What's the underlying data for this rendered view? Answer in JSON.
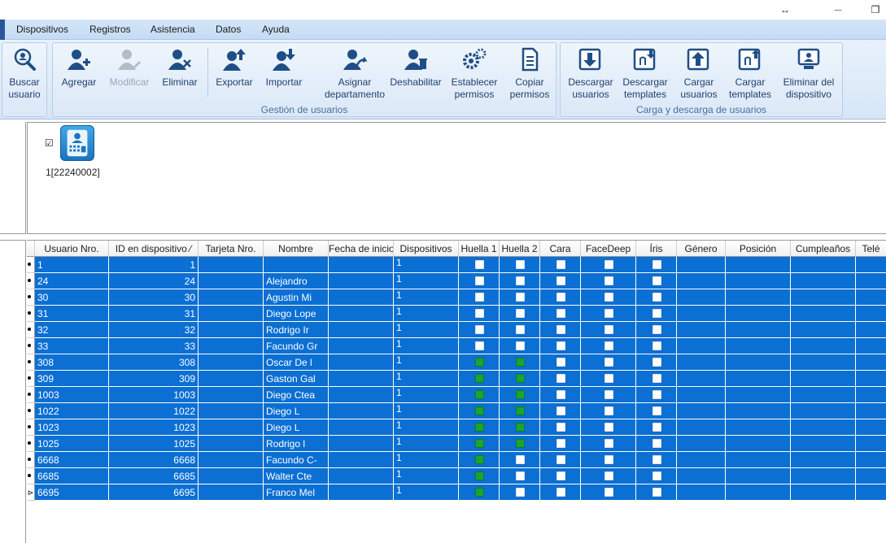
{
  "titlebar": {
    "resize_glyph": "↔",
    "minimize_glyph": "—",
    "restore_glyph": "❐"
  },
  "menu": [
    "Dispositivos",
    "Registros",
    "Asistencia",
    "Datos",
    "Ayuda"
  ],
  "ribbon": {
    "search": {
      "label": "Buscar usuario",
      "icon": "magnifier-user-icon"
    },
    "group_users": {
      "label": "Gestión de usuarios",
      "buttons": [
        {
          "label": "Agregar",
          "icon": "user-add-icon",
          "enabled": true
        },
        {
          "label": "Modificar",
          "icon": "user-edit-icon",
          "enabled": false
        },
        {
          "label": "Eliminar",
          "icon": "user-delete-icon",
          "enabled": true
        },
        {
          "label": "Exportar",
          "icon": "user-export-icon",
          "enabled": true
        },
        {
          "label": "Importar",
          "icon": "user-import-icon",
          "enabled": true
        },
        {
          "label": "Asignar departamento",
          "icon": "user-assign-icon",
          "enabled": true
        },
        {
          "label": "Deshabilitar",
          "icon": "user-disable-icon",
          "enabled": true
        },
        {
          "label": "Establecer permisos",
          "icon": "gears-icon",
          "enabled": true
        },
        {
          "label": "Copiar permisos",
          "icon": "document-copy-icon",
          "enabled": true
        }
      ]
    },
    "group_transfer": {
      "label": "Carga y descarga de usuarios",
      "buttons": [
        {
          "label": "Descargar usuarios",
          "icon": "download-users-icon"
        },
        {
          "label": "Descargar templates",
          "icon": "download-templates-icon"
        },
        {
          "label": "Cargar usuarios",
          "icon": "upload-users-icon"
        },
        {
          "label": "Cargar templates",
          "icon": "upload-templates-icon"
        },
        {
          "label": "Eliminar del dispositivo",
          "icon": "delete-from-device-icon"
        }
      ]
    }
  },
  "device": {
    "checked_glyph": "☑",
    "label": "1[22240002]"
  },
  "grid": {
    "columns": [
      "Usuario Nro.",
      "ID en dispositivo ⁄",
      "Tarjeta Nro.",
      "Nombre",
      "Fecha de inicio",
      "Dispositivos",
      "Huella 1",
      "Huella 2",
      "Cara",
      "FaceDeep",
      "Íris",
      "Género",
      "Posición",
      "Cumpleaños",
      "Telé"
    ],
    "last_row_indicator": "⊳",
    "rows": [
      {
        "user": "1",
        "devid": "1",
        "card": "",
        "name": "",
        "start": "",
        "devices": "1",
        "f1": false,
        "f2": false
      },
      {
        "user": "24",
        "devid": "24",
        "card": "",
        "name": "Alejandro",
        "start": "",
        "devices": "1",
        "f1": false,
        "f2": false
      },
      {
        "user": "30",
        "devid": "30",
        "card": "",
        "name": "Agustin Mi",
        "start": "",
        "devices": "1",
        "f1": false,
        "f2": false
      },
      {
        "user": "31",
        "devid": "31",
        "card": "",
        "name": "Diego Lope",
        "start": "",
        "devices": "1",
        "f1": false,
        "f2": false
      },
      {
        "user": "32",
        "devid": "32",
        "card": "",
        "name": "Rodrigo Ir",
        "start": "",
        "devices": "1",
        "f1": false,
        "f2": false
      },
      {
        "user": "33",
        "devid": "33",
        "card": "",
        "name": "Facundo Gr",
        "start": "",
        "devices": "1",
        "f1": false,
        "f2": false
      },
      {
        "user": "308",
        "devid": "308",
        "card": "",
        "name": "Oscar De l",
        "start": "",
        "devices": "1",
        "f1": true,
        "f2": true
      },
      {
        "user": "309",
        "devid": "309",
        "card": "",
        "name": "Gaston Gal",
        "start": "",
        "devices": "1",
        "f1": true,
        "f2": true
      },
      {
        "user": "1003",
        "devid": "1003",
        "card": "",
        "name": "Diego Ctea",
        "start": "",
        "devices": "1",
        "f1": true,
        "f2": true
      },
      {
        "user": "1022",
        "devid": "1022",
        "card": "",
        "name": "Diego L",
        "start": "",
        "devices": "1",
        "f1": true,
        "f2": true
      },
      {
        "user": "1023",
        "devid": "1023",
        "card": "",
        "name": "Diego L",
        "start": "",
        "devices": "1",
        "f1": true,
        "f2": true
      },
      {
        "user": "1025",
        "devid": "1025",
        "card": "",
        "name": "Rodrigo l",
        "start": "",
        "devices": "1",
        "f1": true,
        "f2": true
      },
      {
        "user": "6668",
        "devid": "6668",
        "card": "",
        "name": "Facundo C-",
        "start": "",
        "devices": "1",
        "f1": true,
        "f2": false
      },
      {
        "user": "6685",
        "devid": "6685",
        "card": "",
        "name": "Walter Cte",
        "start": "",
        "devices": "1",
        "f1": true,
        "f2": false
      },
      {
        "user": "6695",
        "devid": "6695",
        "card": "",
        "name": "Franco Mel",
        "start": "",
        "devices": "1",
        "f1": true,
        "f2": false
      }
    ]
  },
  "colors": {
    "selection": "#0b6fd3",
    "fingerprint_on": "#1aa337",
    "ribbon_text": "#1f3f6e",
    "group_label": "#4a6f9c"
  }
}
